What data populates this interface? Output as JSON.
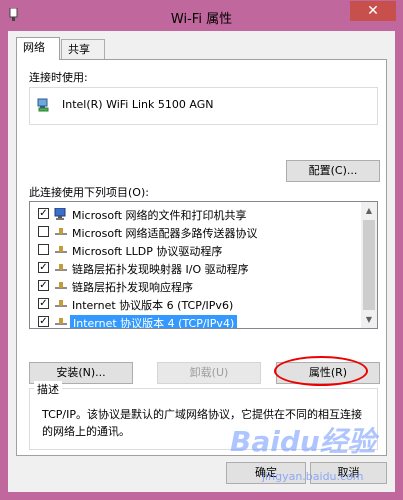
{
  "window": {
    "title": "Wi-Fi 属性",
    "close_glyph": "✕"
  },
  "tabs": [
    {
      "label": "网络"
    },
    {
      "label": "共享"
    }
  ],
  "connect_using": {
    "label": "连接时使用:",
    "adapter": "Intel(R) WiFi Link 5100 AGN",
    "configure_label": "配置(C)..."
  },
  "items": {
    "label": "此连接使用下列项目(O):",
    "list": [
      {
        "text": "Microsoft 网络的文件和打印机共享",
        "checked": true,
        "icon": "network-client-icon"
      },
      {
        "text": "Microsoft 网络适配器多路传送器协议",
        "checked": false,
        "icon": "protocol-icon"
      },
      {
        "text": "Microsoft LLDP 协议驱动程序",
        "checked": false,
        "icon": "protocol-icon"
      },
      {
        "text": "链路层拓扑发现映射器 I/O 驱动程序",
        "checked": true,
        "icon": "protocol-icon"
      },
      {
        "text": "链路层拓扑发现响应程序",
        "checked": true,
        "icon": "protocol-icon"
      },
      {
        "text": "Internet 协议版本 6 (TCP/IPv6)",
        "checked": true,
        "icon": "protocol-icon"
      },
      {
        "text": "Internet 协议版本 4 (TCP/IPv4)",
        "checked": true,
        "icon": "protocol-icon",
        "selected": true
      }
    ]
  },
  "buttons": {
    "install": "安装(N)...",
    "uninstall": "卸载(U)",
    "properties": "属性(R)",
    "ok": "确定",
    "cancel": "取消"
  },
  "description": {
    "title": "描述",
    "text": "TCP/IP。该协议是默认的广域网络协议，它提供在不同的相互连接的网络上的通讯。"
  },
  "colors": {
    "window_frame": "#c0679d",
    "close_button": "#c7504c",
    "selection": "#3399ff",
    "annotation": "#e00000"
  },
  "watermark": {
    "logo": "Baidu经验",
    "url": "jingyan.baidu.com"
  }
}
